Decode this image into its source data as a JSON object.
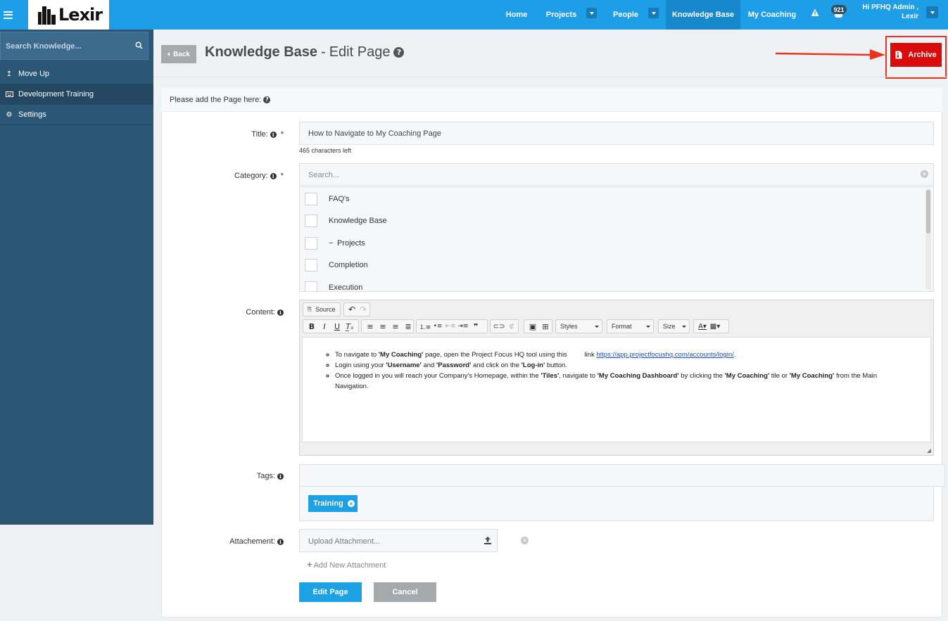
{
  "topbar": {
    "logo_text": "Lexir",
    "nav": [
      {
        "label": "Home"
      },
      {
        "label": "Projects"
      },
      {
        "label": "People"
      },
      {
        "label": "Knowledge Base"
      },
      {
        "label": "My Coaching"
      }
    ],
    "notification_count": "921",
    "user_greeting": "Hi PFHQ Admin ,",
    "user_name": "Lexir"
  },
  "sidebar": {
    "search_placeholder": "Search Knowledge...",
    "items": [
      {
        "label": "Move Up"
      },
      {
        "label": "Development Training"
      },
      {
        "label": "Settings"
      }
    ]
  },
  "header": {
    "back_label": "Back",
    "title_main": "Knowledge Base",
    "title_sep": "-",
    "title_sub": "Edit Page",
    "archive_label": "Archive"
  },
  "form": {
    "intro": "Please add the Page here:",
    "title_label": "Title:",
    "title_value": "How to Navigate to My Coaching Page",
    "title_hint": "465 characters left",
    "category_label": "Category:",
    "category_search_placeholder": "Search...",
    "categories": [
      {
        "label": "FAQ's"
      },
      {
        "label": "Knowledge Base"
      },
      {
        "label": "Projects"
      },
      {
        "label": "Completion"
      },
      {
        "label": "Execution"
      }
    ],
    "content_label": "Content:",
    "tags_label": "Tags:",
    "tags": [
      "Training"
    ],
    "attachment_label": "Attachement:",
    "attachment_placeholder": "Upload Attachment...",
    "add_attachment": "Add New Attachment",
    "submit_label": "Edit Page",
    "cancel_label": "Cancel"
  },
  "editor": {
    "source_label": "Source",
    "styles_label": "Styles",
    "format_label": "Format",
    "size_label": "Size",
    "content": {
      "li1_a": "To navigate to ",
      "li1_b": "'My Coaching'",
      "li1_c": " page, open the Project Focus HQ tool using this ",
      "li1_d": "link ",
      "li1_link": "https://app.projectfocushq.com/accounts/login/",
      "li1_e": ".",
      "li2_a": "Login using your ",
      "li2_b": "'Username'",
      "li2_c": " and ",
      "li2_d": "'Password'",
      "li2_e": " and click on the ",
      "li2_f": "'Log-in'",
      "li2_g": " button.",
      "li3_a": "Once logged in you will reach your Company's Homepage, within the ",
      "li3_b": "'Tiles'",
      "li3_c": ", navigate to  ",
      "li3_d": "'My Coaching Dashboard'",
      "li3_e": " by clicking the ",
      "li3_f": "'My Coaching'",
      "li3_g": " tile or  ",
      "li3_h": "'My Coaching'",
      "li3_i": " from the Main Navigation."
    }
  },
  "colors": {
    "topbar": "#1f9ee8",
    "nav_active": "#1788cc",
    "sidebar": "#2b5675",
    "archive": "#d90b0b",
    "annotation": "#e8331d",
    "primary_button": "#1ba1e4"
  }
}
